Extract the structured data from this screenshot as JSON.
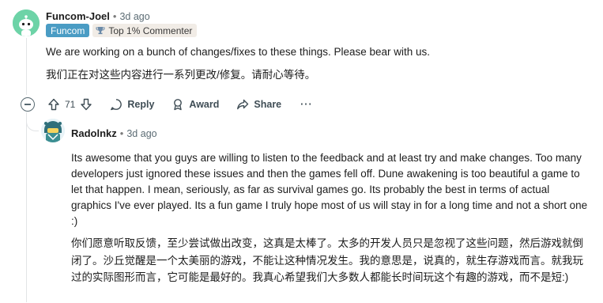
{
  "comment": {
    "username": "Funcom-Joel",
    "separator": "•",
    "time": "3d ago",
    "flair_team": "Funcom",
    "flair_badge": "Top 1% Commenter",
    "text_en": "We are working on a bunch of changes/fixes to these things. Please bear with us.",
    "text_zh": "我们正在对这些内容进行一系列更改/修复。请耐心等待。",
    "votes": "71",
    "reply_label": "Reply",
    "award_label": "Award",
    "share_label": "Share",
    "more_label": "···"
  },
  "reply": {
    "username": "Radolnkz",
    "separator": "•",
    "time": "3d ago",
    "text_en": "Its awesome that you guys are willing to listen to the feedback and at least try and make changes. Too many developers just ignored these issues and then the games fell off. Dune awakening is too beautiful a game to let that happen. I mean, seriously, as far as survival games go. Its probably the best in terms of actual graphics I've ever played. Its a fun game I truly hope most of us will stay in for a long time and not a short one :)",
    "text_zh": "你们愿意听取反馈，至少尝试做出改变，这真是太棒了。太多的开发人员只是忽视了这些问题，然后游戏就倒闭了。沙丘觉醒是一个太美丽的游戏，不能让这种情况发生。我的意思是，说真的，就生存游戏而言。就我玩过的实际图形而言，它可能是最好的。我真心希望我们大多数人都能长时间玩这个有趣的游戏，而不是短:)"
  },
  "colors": {
    "flair_team_bg": "#4a9cc4",
    "flair_badge_bg": "#f1ece6",
    "meta_text": "#5c6c74"
  },
  "icons": {
    "main_avatar": "snoo-avatar-green",
    "reply_avatar": "snoo-avatar-helmet",
    "badge": "trophy-icon",
    "collapse": "collapse-minus-icon",
    "upvote": "upvote-arrow-icon",
    "downvote": "downvote-arrow-icon",
    "reply": "speech-bubble-icon",
    "award": "award-medal-icon",
    "share": "share-arrow-icon",
    "more": "more-dots-icon"
  }
}
